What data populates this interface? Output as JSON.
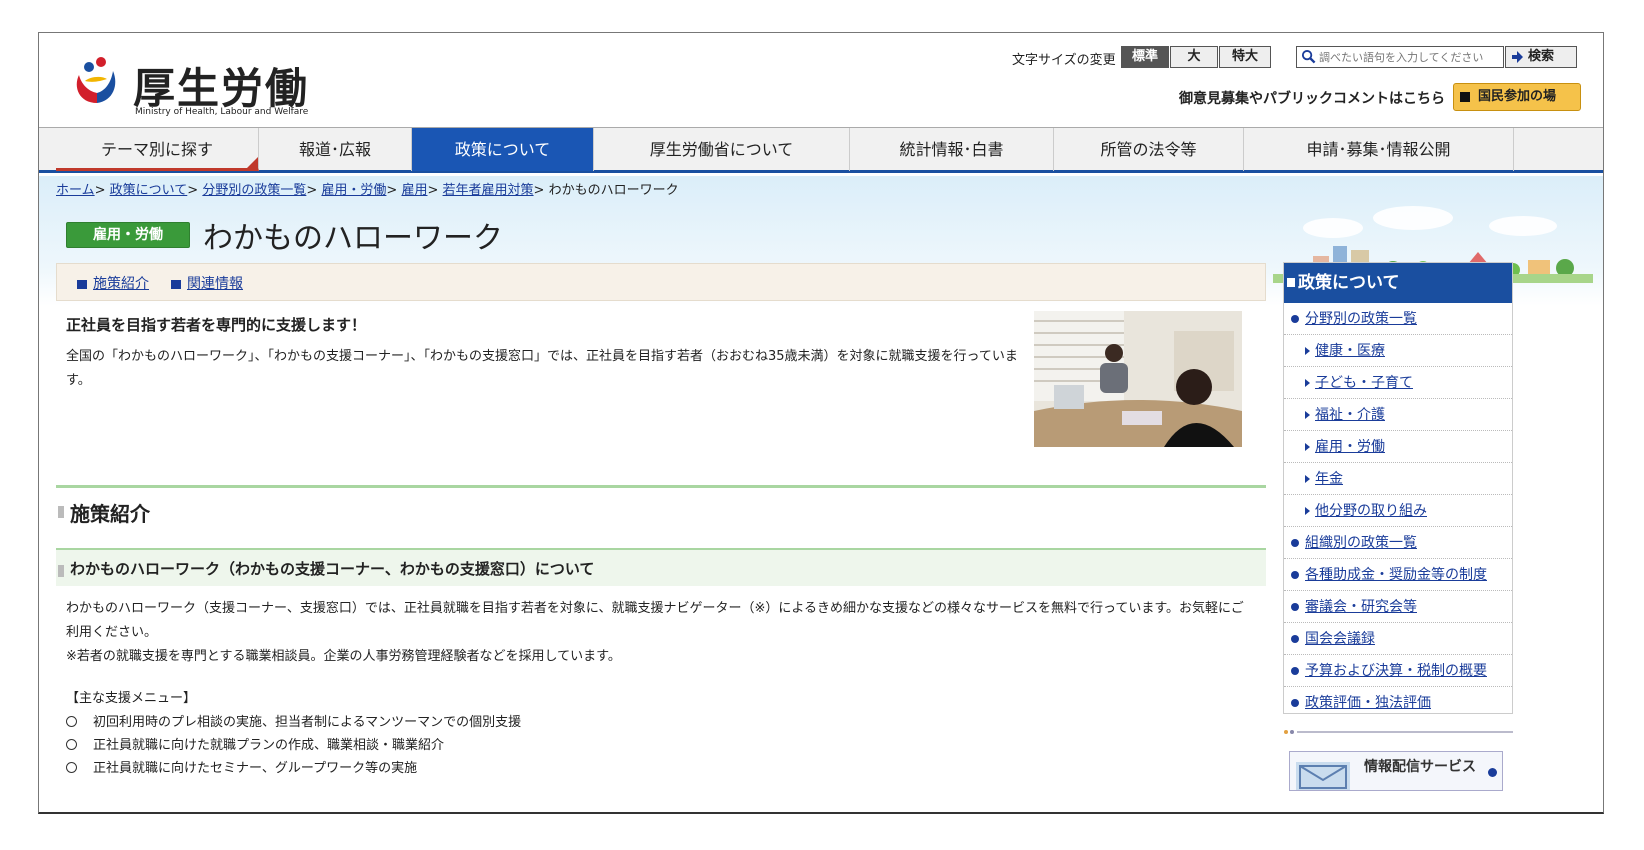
{
  "header": {
    "logo_title": "厚生労働省",
    "logo_subtitle": "Ministry of Health, Labour and Welfare",
    "font_size_label": "文字サイズの変更",
    "font_sizes": [
      "標準",
      "大",
      "特大"
    ],
    "search_placeholder": "調べたい語句を入力してください",
    "search_button": "検索",
    "public_comment_text": "御意見募集やパブリックコメントはこちら",
    "participation_button": "国民参加の場"
  },
  "nav": {
    "items": [
      "テーマ別に探す",
      "報道･広報",
      "政策について",
      "厚生労働省について",
      "統計情報･白書",
      "所管の法令等",
      "申請･募集･情報公開"
    ],
    "active_index": 2
  },
  "breadcrumb": {
    "links": [
      "ホーム",
      "政策について",
      "分野別の政策一覧",
      "雇用・労働",
      "雇用",
      "若年者雇用対策"
    ],
    "separator": ">",
    "current": "わかものハローワーク"
  },
  "page": {
    "category": "雇用・労働",
    "title": "わかものハローワーク",
    "anchors": [
      "施策紹介",
      "関連情報"
    ],
    "intro_heading": "正社員を目指す若者を専門的に支援します！",
    "intro_text": "全国の「わかものハローワーク」、「わかもの支援コーナー」、「わかもの支援窓口」では、正社員を目指す若者（おおむね35歳未満）を対象に就職支援を行っています。",
    "section_title": "施策紹介",
    "subsection_title": "わかものハローワーク（わかもの支援コーナー、わかもの支援窓口）について",
    "body_line1": "わかものハローワーク（支援コーナー、支援窓口）では、正社員就職を目指す若者を対象に、就職支援ナビゲーター（※）によるきめ細かな支援などの様々なサービスを無料で行っています。お気軽にご利用ください。",
    "body_line2": "※若者の就職支援を専門とする職業相談員。企業の人事労務管理経験者などを採用しています。",
    "menu_title": "【主な支援メニュー】",
    "menu_items": [
      "初回利用時のプレ相談の実施、担当者制によるマンツーマンでの個別支援",
      "正社員就職に向けた就職プランの作成、職業相談・職業紹介",
      "正社員就職に向けたセミナー、グループワーク等の実施"
    ]
  },
  "sidebar": {
    "title": "政策について",
    "items": [
      {
        "label": "分野別の政策一覧",
        "level": 1
      },
      {
        "label": "健康・医療",
        "level": 2
      },
      {
        "label": "子ども・子育て",
        "level": 2
      },
      {
        "label": "福祉・介護",
        "level": 2
      },
      {
        "label": "雇用・労働",
        "level": 2
      },
      {
        "label": "年金",
        "level": 2
      },
      {
        "label": "他分野の取り組み",
        "level": 2
      },
      {
        "label": "組織別の政策一覧",
        "level": 1
      },
      {
        "label": "各種助成金・奨励金等の制度",
        "level": 1
      },
      {
        "label": "審議会・研究会等",
        "level": 1
      },
      {
        "label": "国会会議録",
        "level": 1
      },
      {
        "label": "予算および決算・税制の概要",
        "level": 1
      },
      {
        "label": "政策評価・独法評価",
        "level": 1
      }
    ],
    "banner": "情報配信サービス"
  },
  "colors": {
    "nav_active": "#1a56b4",
    "category_badge": "#3a9a3a",
    "link": "#1a3c9a",
    "participation_button": "#f5c24a"
  }
}
